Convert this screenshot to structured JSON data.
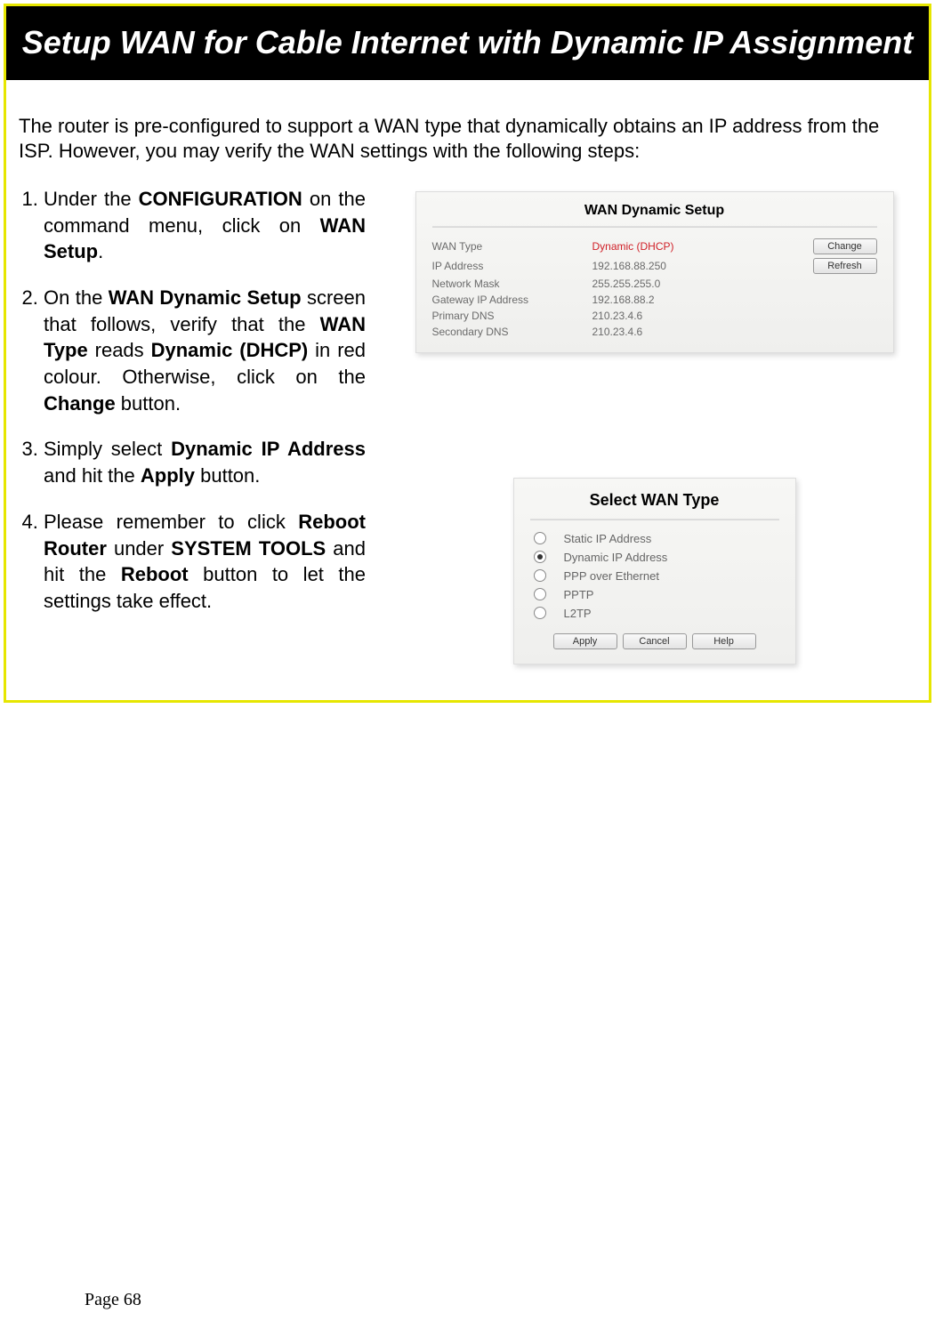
{
  "title": "Setup WAN for Cable Internet with Dynamic IP Assignment",
  "intro": "The router is pre-configured to support a WAN type that dynamically obtains an IP address from the ISP. However, you may verify the WAN settings with the following steps:",
  "steps": {
    "s1a": "Under the ",
    "s1b": "CONFIGURATION",
    "s1c": " on the command menu, click on ",
    "s1d": "WAN Setup",
    "s1e": ".",
    "s2a": "On the ",
    "s2b": "WAN Dynamic Setup",
    "s2c": " screen that follows, verify that the ",
    "s2d": "WAN Type",
    "s2e": " reads ",
    "s2f": "Dynamic (DHCP)",
    "s2g": " in red colour. Otherwise, click on the ",
    "s2h": "Change",
    "s2i": " button.",
    "s3a": "Simply select ",
    "s3b": "Dynamic IP Address",
    "s3c": " and hit the ",
    "s3d": "Apply",
    "s3e": " button.",
    "s4a": "Please remember to click ",
    "s4b": "Reboot Router",
    "s4c": " under ",
    "s4d": "SYSTEM TOOLS",
    "s4e": " and hit the ",
    "s4f": "Reboot",
    "s4g": " button to let the settings take effect."
  },
  "shot1": {
    "title": "WAN Dynamic Setup",
    "rows": [
      {
        "label": "WAN Type",
        "value": "Dynamic (DHCP)",
        "red": true
      },
      {
        "label": "IP Address",
        "value": "192.168.88.250"
      },
      {
        "label": "Network Mask",
        "value": "255.255.255.0"
      },
      {
        "label": "Gateway IP Address",
        "value": "192.168.88.2"
      },
      {
        "label": "Primary DNS",
        "value": "210.23.4.6"
      },
      {
        "label": "Secondary DNS",
        "value": "210.23.4.6"
      }
    ],
    "buttons": {
      "change": "Change",
      "refresh": "Refresh"
    }
  },
  "shot2": {
    "title": "Select WAN Type",
    "options": [
      {
        "label": "Static IP Address",
        "selected": false
      },
      {
        "label": "Dynamic IP Address",
        "selected": true
      },
      {
        "label": "PPP over Ethernet",
        "selected": false
      },
      {
        "label": "PPTP",
        "selected": false
      },
      {
        "label": "L2TP",
        "selected": false
      }
    ],
    "buttons": {
      "apply": "Apply",
      "cancel": "Cancel",
      "help": "Help"
    }
  },
  "footer": "Page 68"
}
